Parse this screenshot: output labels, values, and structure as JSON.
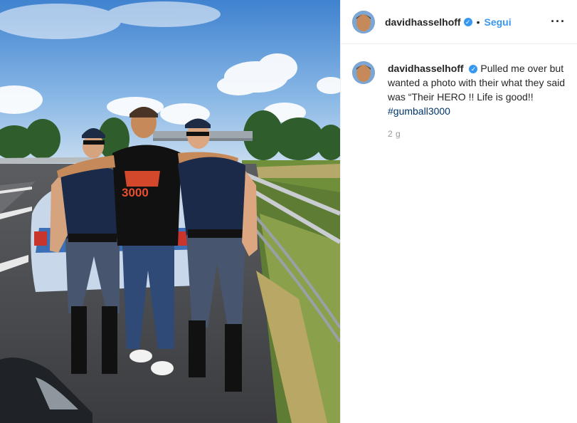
{
  "post": {
    "username": "davidhasselhoff",
    "verified_glyph": "✓",
    "separator": "•",
    "follow_label": "Segui",
    "more_label": "···",
    "caption": "Pulled me over but wanted a photo with their what they said was “Their HERO !! Life is good!!",
    "hashtag": "#gumball3000",
    "time_ago": "2 g"
  },
  "photo": {
    "shirt_text": "3000",
    "icons": [
      "avatar"
    ]
  },
  "colors": {
    "accent": "#3897f0",
    "hashtag": "#003569",
    "muted": "#999999"
  }
}
